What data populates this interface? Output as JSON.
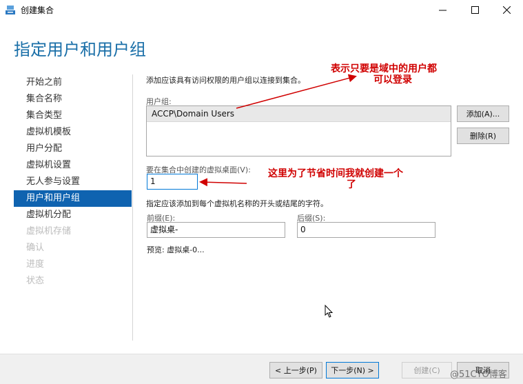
{
  "window": {
    "title": "创建集合",
    "icons": {
      "app": "server-app-icon",
      "minimize": "minimize-icon",
      "maximize": "maximize-icon",
      "close": "close-icon"
    }
  },
  "page": {
    "title": "指定用户和用户组"
  },
  "nav": {
    "items": [
      {
        "label": "开始之前",
        "state": "normal"
      },
      {
        "label": "集合名称",
        "state": "normal"
      },
      {
        "label": "集合类型",
        "state": "normal"
      },
      {
        "label": "虚拟机模板",
        "state": "normal"
      },
      {
        "label": "用户分配",
        "state": "normal"
      },
      {
        "label": "虚拟机设置",
        "state": "normal"
      },
      {
        "label": "无人参与设置",
        "state": "normal"
      },
      {
        "label": "用户和用户组",
        "state": "active"
      },
      {
        "label": "虚拟机分配",
        "state": "normal"
      },
      {
        "label": "虚拟机存储",
        "state": "disabled"
      },
      {
        "label": "确认",
        "state": "disabled"
      },
      {
        "label": "进度",
        "state": "disabled"
      },
      {
        "label": "状态",
        "state": "disabled"
      }
    ]
  },
  "content": {
    "intro": "添加应该具有访问权限的用户组以连接到集合。",
    "user_groups_label": "用户组:",
    "user_groups": [
      "ACCP\\Domain Users"
    ],
    "add_button": "添加(A)...",
    "remove_button": "删除(R)",
    "count_label": "要在集合中创建的虚拟桌面(V):",
    "count_value": "1",
    "naming_desc": "指定应该添加到每个虚拟机名称的开头或结尾的字符。",
    "prefix_label": "前缀(E):",
    "prefix_value": "虚拟桌-",
    "suffix_label": "后缀(S):",
    "suffix_value": "0",
    "preview": "预览: 虚拟桌-0..."
  },
  "annotations": {
    "note1_line1": "表示只要是域中的用户都",
    "note1_line2": "可以登录",
    "note2_line1": "这里为了节省时间我就创建一个",
    "note2_line2": "了",
    "color": "#d00000"
  },
  "footer": {
    "prev_button": "< 上一步(P)",
    "next_button": "下一步(N) >",
    "create_button": "创建(C)",
    "cancel_button": "取消"
  },
  "watermark": "@51CTO博客",
  "colors": {
    "accent": "#1a6fa8",
    "nav_active": "#0f63b0",
    "focus_border": "#0078d7"
  }
}
